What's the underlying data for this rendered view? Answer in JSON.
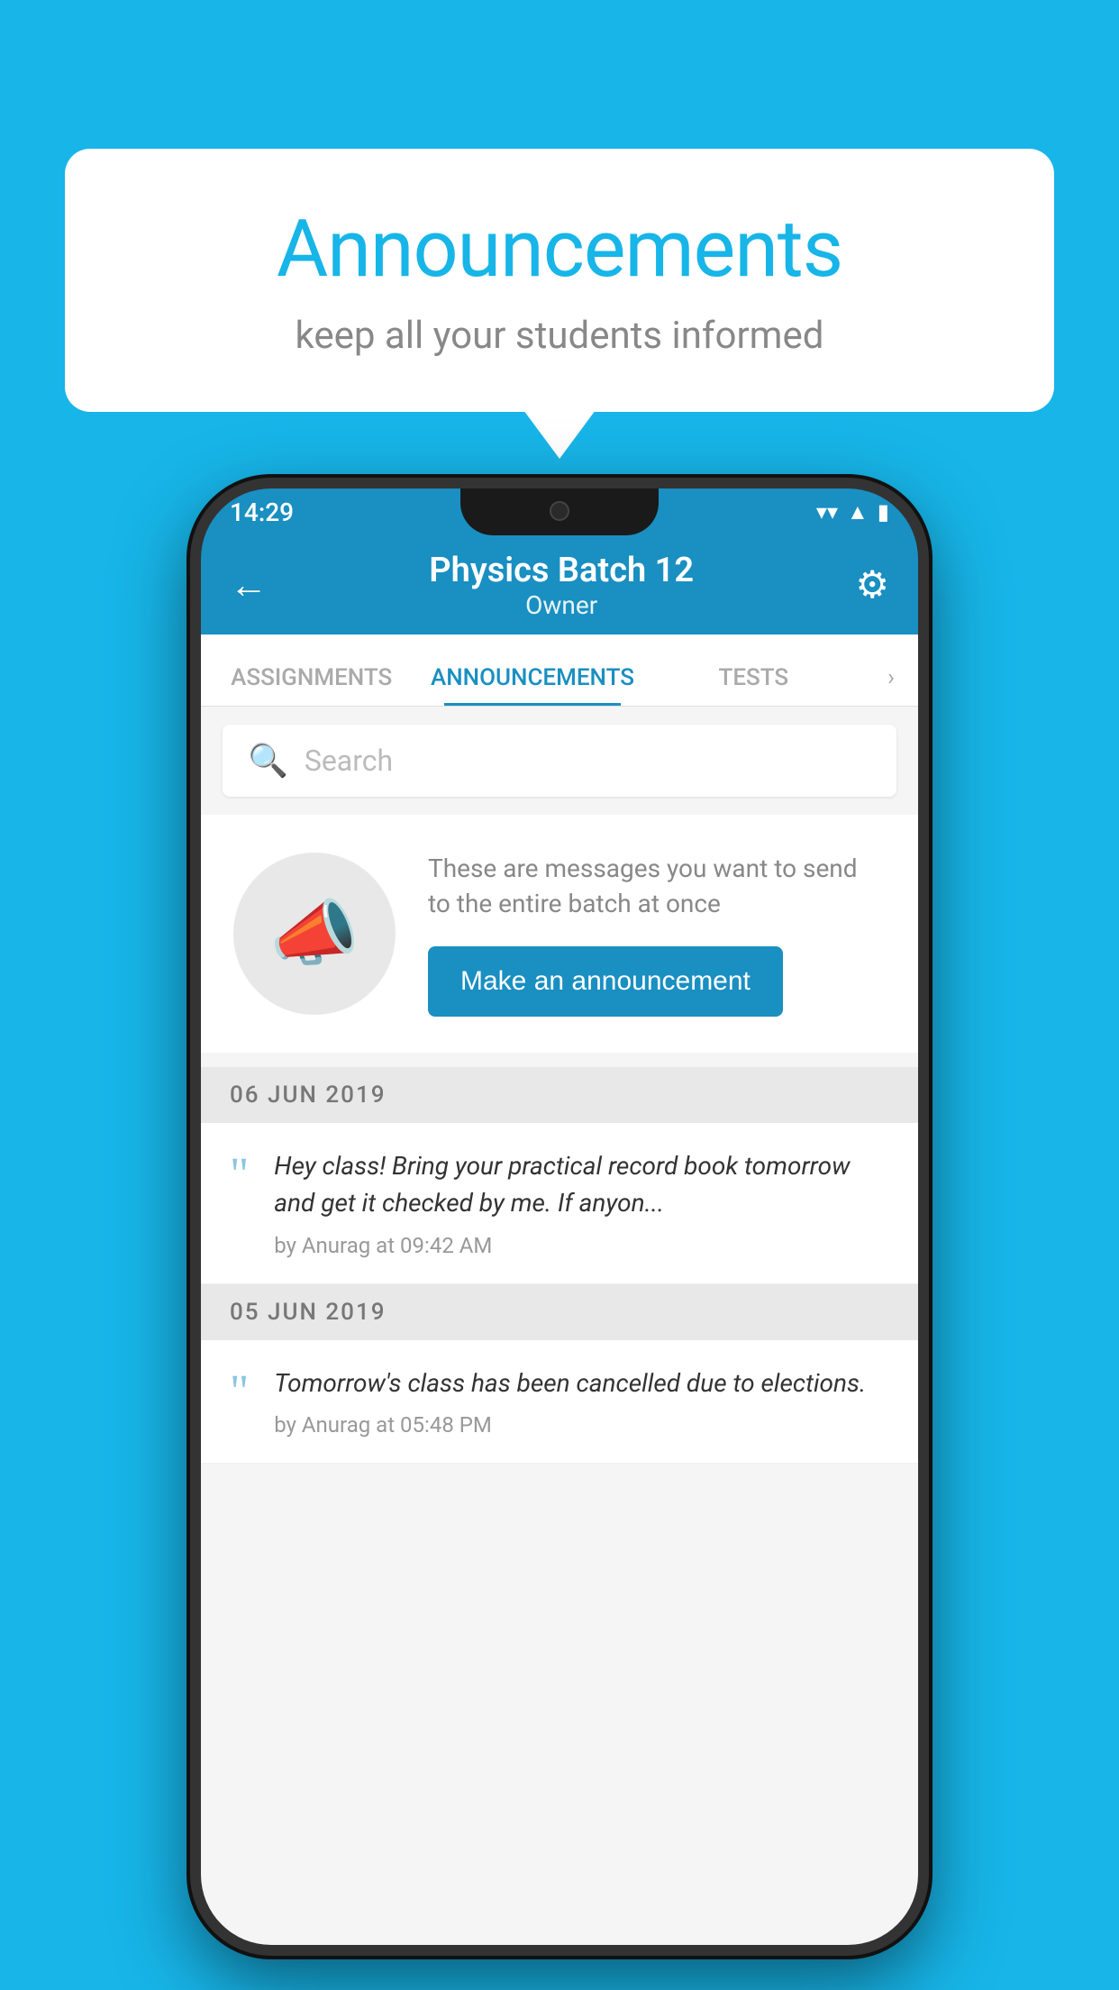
{
  "hero": {
    "title": "Announcements",
    "subtitle": "keep all your students informed"
  },
  "statusBar": {
    "time": "14:29",
    "wifi": "▼",
    "signal": "▲",
    "battery": "▮"
  },
  "header": {
    "title": "Physics Batch 12",
    "subtitle": "Owner",
    "backLabel": "←",
    "gearLabel": "⚙"
  },
  "tabs": [
    {
      "label": "ASSIGNMENTS",
      "active": false
    },
    {
      "label": "ANNOUNCEMENTS",
      "active": true
    },
    {
      "label": "TESTS",
      "active": false
    }
  ],
  "search": {
    "placeholder": "Search"
  },
  "announcementPrompt": {
    "description": "These are messages you want to send to the entire batch at once",
    "buttonLabel": "Make an announcement"
  },
  "dateSections": [
    {
      "date": "06  JUN  2019",
      "items": [
        {
          "text": "Hey class! Bring your practical record book tomorrow and get it checked by me. If anyon...",
          "meta": "by Anurag at 09:42 AM"
        }
      ]
    },
    {
      "date": "05  JUN  2019",
      "items": [
        {
          "text": "Tomorrow's class has been cancelled due to elections.",
          "meta": "by Anurag at 05:48 PM"
        }
      ]
    }
  ]
}
